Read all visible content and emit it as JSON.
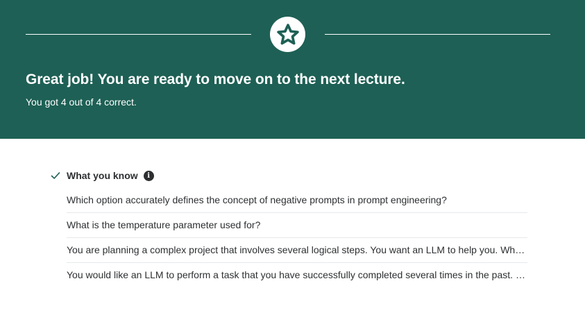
{
  "banner": {
    "title": "Great job! You are ready to move on to the next lecture.",
    "score_text": "You got 4 out of 4 correct.",
    "icon": "star-icon",
    "background_color": "#1e6055"
  },
  "results": {
    "section_label": "What you know",
    "status_icon": "checkmark-icon",
    "info_icon": "info-icon",
    "info_glyph": "i",
    "questions": [
      "Which option accurately defines the concept of negative prompts in prompt engineering?",
      "What is the temperature parameter used for?",
      "You are planning a complex project that involves several logical steps. You want an LLM to help you. What approach should you take?",
      "You would like an LLM to perform a task that you have successfully completed several times in the past. What should you do?"
    ]
  }
}
